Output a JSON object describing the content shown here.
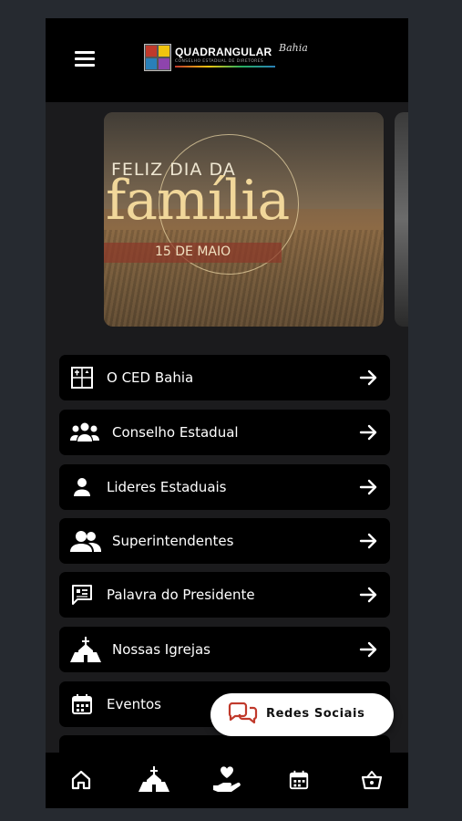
{
  "header": {
    "menu_icon": "hamburger-menu-icon",
    "logo_title": "QUADRANGULAR",
    "logo_script": "Bahia",
    "logo_subtitle": "CONSELHO ESTADUAL DE DIRETORES"
  },
  "carousel": {
    "slides": [
      {
        "line1": "FELIZ DIA DA",
        "line2": "família",
        "line3": "15 DE MAIO"
      }
    ]
  },
  "menu": {
    "items": [
      {
        "label": "O CED Bahia",
        "icon": "ced-logo-icon"
      },
      {
        "label": "Conselho Estadual",
        "icon": "group-icon"
      },
      {
        "label": "Lideres Estaduais",
        "icon": "person-icon"
      },
      {
        "label": "Superintendentes",
        "icon": "people-icon"
      },
      {
        "label": "Palavra do Presidente",
        "icon": "message-icon"
      },
      {
        "label": "Nossas Igrejas",
        "icon": "church-icon"
      },
      {
        "label": "Eventos",
        "icon": "calendar-icon"
      }
    ],
    "arrow_icon": "arrow-right-icon"
  },
  "fab": {
    "label": "Redes Sociais",
    "icon": "chat-bubbles-icon",
    "accent": "#c0392b"
  },
  "bottom_nav": {
    "items": [
      {
        "icon": "home-icon"
      },
      {
        "icon": "church-icon"
      },
      {
        "icon": "hand-heart-icon"
      },
      {
        "icon": "calendar-icon"
      },
      {
        "icon": "basket-icon"
      }
    ]
  },
  "colors": {
    "background": "#262a30",
    "screen": "#1b1b1d",
    "bar": "#000000",
    "item": "#000000",
    "text": "#ffffff"
  }
}
